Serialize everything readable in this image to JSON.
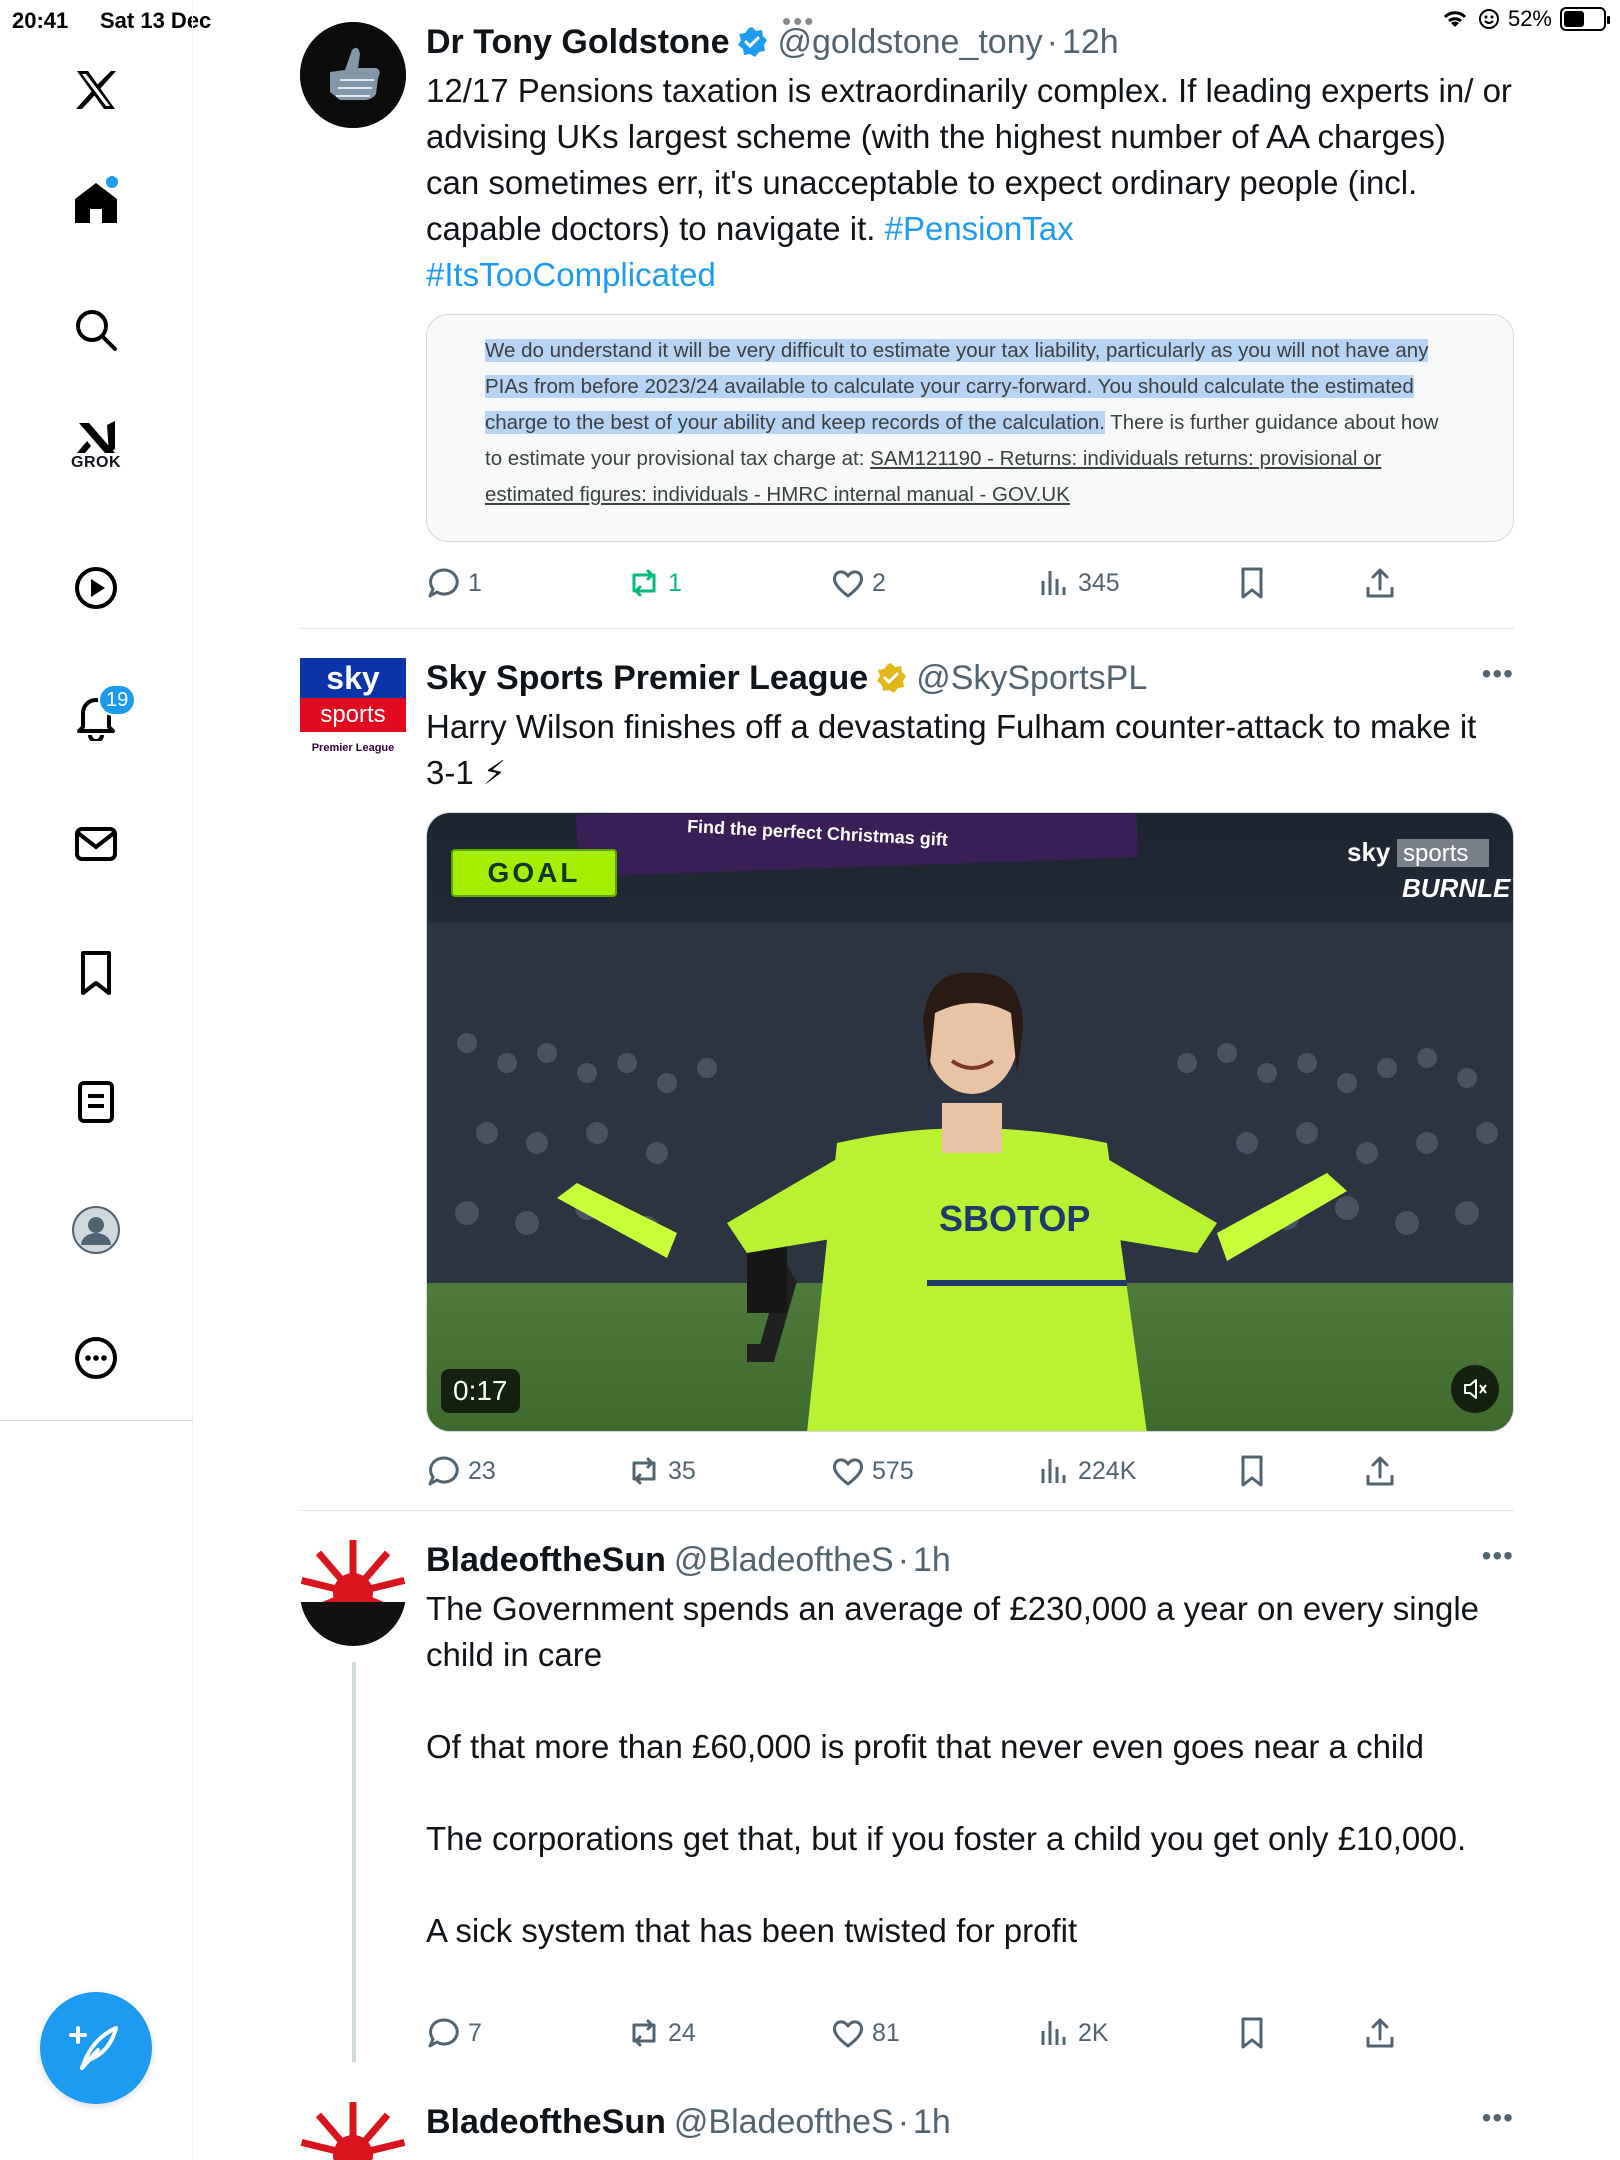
{
  "status_bar": {
    "time": "20:41",
    "date": "Sat 13 Dec",
    "battery": "52%",
    "battery_level": 0.52
  },
  "sidebar": {
    "grok_label": "GROK",
    "notifications_badge": "19"
  },
  "tweets": [
    {
      "name": "Dr Tony Goldstone",
      "handle": "@goldstone_tony",
      "time": "12h",
      "text_plain": "12/17 Pensions taxation is extraordinarily complex. If leading experts in/ or advising UKs largest scheme (with the highest number of AA charges)  can sometimes err, it's unacceptable to expect ordinary people (incl. capable doctors) to navigate it. ",
      "hashtag1": "#PensionTax",
      "hashtag2": "#ItsTooComplicated",
      "card": {
        "line1": "We do understand it will be very difficult to estimate your tax liability, particularly as you will not have any",
        "line2": "PIAs from before 2023/24 available to calculate your carry-forward. You should calculate the estimated",
        "line3a": "charge to the best of your ability and keep records of the calculation.",
        "line3b": " There is further guidance about how",
        "line4a": "to estimate your provisional tax charge at: ",
        "line4b": "SAM121190 - Returns: individuals returns: provisional or",
        "line5": "estimated figures: individuals - HMRC internal manual - GOV.UK"
      },
      "replies": "1",
      "reposts": "1",
      "likes": "2",
      "views": "345"
    },
    {
      "name": "Sky Sports Premier League",
      "handle": "@SkySportsPL",
      "text": "Harry Wilson finishes off a devastating Fulham counter-attack to make it 3-1 ⚡",
      "avatar_line1": "sky",
      "avatar_line2": "sports",
      "avatar_line3": "Premier League",
      "video": {
        "duration": "0:17",
        "goal_label": "GOAL",
        "banner_text": "Find the perfect Christmas gift",
        "watermark_sky": "sky",
        "watermark_sports": "sports",
        "watermark_team": "BURNLEY",
        "shirt_text": "SBOTOP"
      },
      "replies": "23",
      "reposts": "35",
      "likes": "575",
      "views": "224K"
    },
    {
      "name": "BladeoftheSun",
      "handle": "@BladeoftheS",
      "time": "1h",
      "text": "The Government spends an average of £230,000 a year on every single child in care\n\nOf that more than £60,000 is profit that never even goes near a child\n\nThe corporations get that, but if you foster a child you get only £10,000.\n\nA sick system that has been twisted for profit",
      "replies": "7",
      "reposts": "24",
      "likes": "81",
      "views": "2K"
    },
    {
      "name": "BladeoftheSun",
      "handle": "@BladeoftheS",
      "time": "1h"
    }
  ],
  "colors": {
    "accent": "#1d9bf0",
    "repost_active": "#00ba7c",
    "text_secondary": "#536471"
  }
}
